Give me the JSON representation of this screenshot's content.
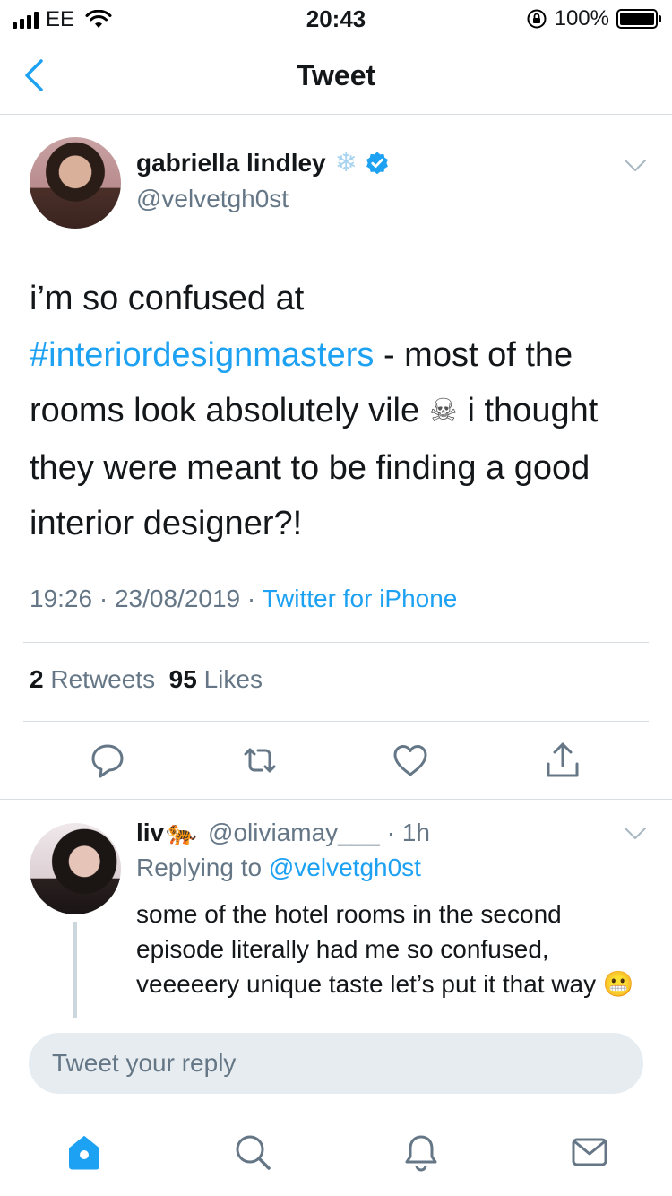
{
  "status_bar": {
    "carrier": "EE",
    "time": "20:43",
    "battery": "100%"
  },
  "nav": {
    "title": "Tweet",
    "back_icon": "chevron-left-icon"
  },
  "tweet": {
    "name": "gabriella lindley",
    "name_emoji": "❄",
    "handle": "@velvetgh0st",
    "text_part1": "i’m so confused at ",
    "hashtag": "#interiordesignmasters",
    "text_part2": " - most of the rooms look absolutely vile ",
    "skull_emoji": "☠",
    "text_part3": " i thought they were meant to be finding a good interior designer?!",
    "time": "19:26",
    "date": "23/08/2019",
    "source": "Twitter for iPhone",
    "retweets_count": "2",
    "retweets_label": "Retweets",
    "likes_count": "95",
    "likes_label": "Likes"
  },
  "reply": {
    "name": "liv",
    "name_emoji": "🐅",
    "handle": "@oliviamay___",
    "time": "1h",
    "replying_prefix": "Replying to ",
    "replying_to": "@velvetgh0st",
    "text": "some of the hotel rooms in the second episode literally had me so confused, veeeeery unique taste let’s put it that way 😬"
  },
  "composer": {
    "placeholder": "Tweet your reply"
  },
  "tab_bar": {
    "items": [
      "home-icon",
      "search-icon",
      "notifications-icon",
      "messages-icon"
    ]
  },
  "colors": {
    "accent": "#1da1f2",
    "secondary_text": "#657786",
    "divider": "#d8dde1",
    "input_bg": "#e6ecf0"
  }
}
